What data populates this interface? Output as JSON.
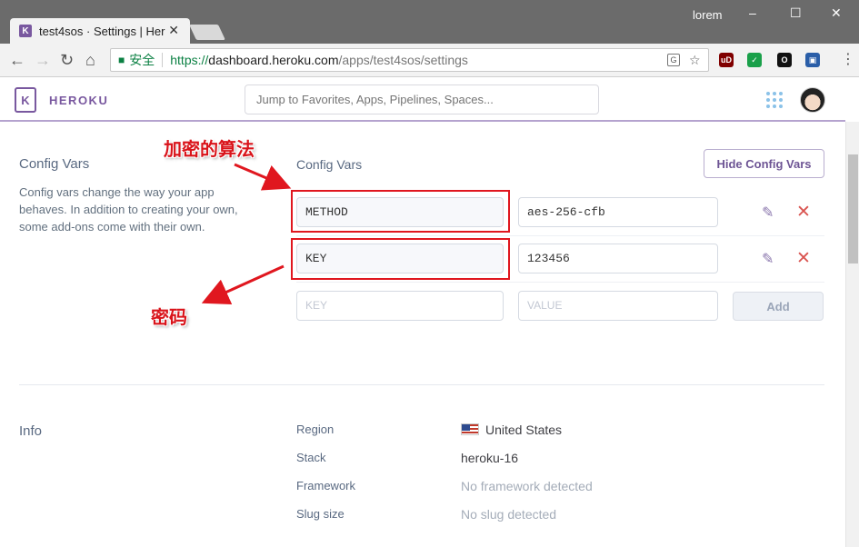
{
  "window": {
    "tab_title": "test4sos · Settings | Her",
    "tab_favicon": "K",
    "user": "lorem",
    "minimize": "–",
    "maximize": "☐",
    "close": "✕",
    "tab_close": "✕"
  },
  "toolbar": {
    "back": "←",
    "forward": "→",
    "reload": "↻",
    "home": "⌂",
    "secure_label": "安全",
    "url_scheme": "https://",
    "url_host": "dashboard.heroku.com",
    "url_path": "/apps/test4sos/settings",
    "translate_icon": "translate-icon",
    "star": "☆",
    "extensions": [
      {
        "name": "ublock-icon",
        "label": "uD",
        "color": "#800000"
      },
      {
        "name": "shield-icon",
        "label": "✓",
        "color": "#1aa04a"
      },
      {
        "name": "ring-icon",
        "label": "O",
        "color": "#111111"
      },
      {
        "name": "save-icon",
        "label": "▣",
        "color": "#2a5ea8"
      }
    ],
    "menu": "⋮"
  },
  "header": {
    "logo_letter": "K",
    "logo_text": "HEROKU",
    "search_placeholder": "Jump to Favorites, Apps, Pipelines, Spaces..."
  },
  "config": {
    "section_title": "Config Vars",
    "description": "Config vars change the way your app behaves. In addition to creating your own, some add-ons come with their own.",
    "column_title": "Config Vars",
    "hide_button": "Hide Config Vars",
    "vars": [
      {
        "key": "METHOD",
        "value": "aes-256-cfb"
      },
      {
        "key": "KEY",
        "value": "123456"
      }
    ],
    "new_key_placeholder": "KEY",
    "new_value_placeholder": "VALUE",
    "add_button": "Add",
    "edit_glyph": "✎",
    "delete_glyph": "✕"
  },
  "annotations": {
    "method_note": "加密的算法",
    "key_note": "密码",
    "color": "#e0171f"
  },
  "info": {
    "section_title": "Info",
    "rows": [
      {
        "label": "Region",
        "value": "United States"
      },
      {
        "label": "Stack",
        "value": "heroku-16"
      },
      {
        "label": "Framework",
        "value": "No framework detected"
      },
      {
        "label": "Slug size",
        "value": "No slug detected"
      }
    ]
  }
}
